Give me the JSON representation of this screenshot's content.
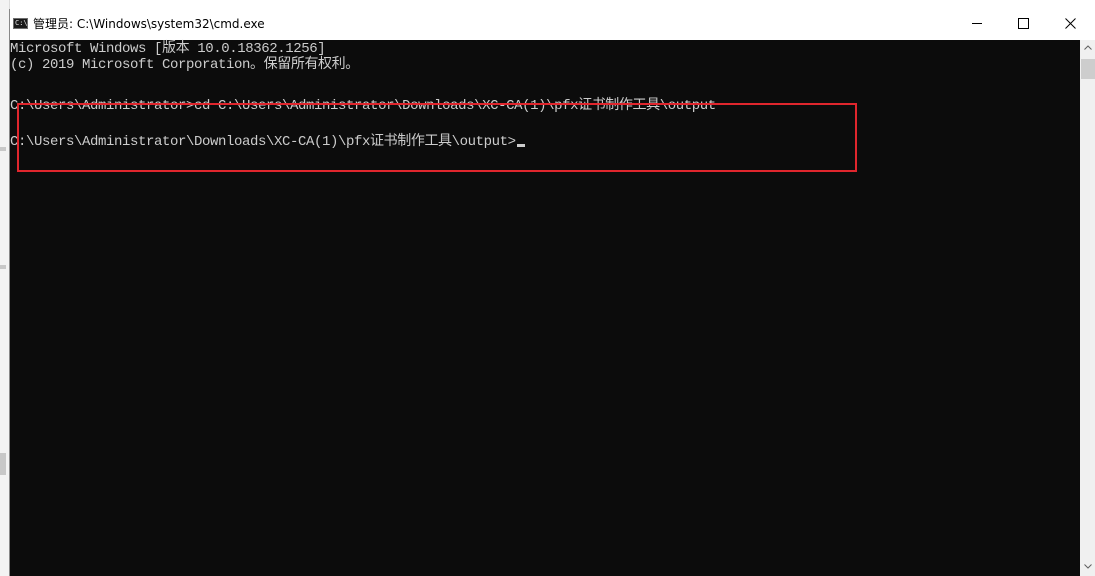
{
  "window": {
    "title": "管理员: C:\\Windows\\system32\\cmd.exe",
    "app_icon": "cmd-icon",
    "app_icon_glyph": "C:\\",
    "controls": {
      "minimize": "minimize-icon",
      "maximize": "maximize-icon",
      "close": "close-icon"
    }
  },
  "console": {
    "lines": [
      "Microsoft Windows [版本 10.0.18362.1256]",
      "(c) 2019 Microsoft Corporation。保留所有权利。",
      "C:\\Users\\Administrator>cd C:\\Users\\Administrator\\Downloads\\XC-CA(1)\\pfx证书制作工具\\output",
      "C:\\Users\\Administrator\\Downloads\\XC-CA(1)\\pfx证书制作工具\\output>"
    ],
    "background_color": "#0c0c0c",
    "text_color": "#cccccc"
  },
  "highlight": {
    "color": "#e0262d"
  },
  "scrollbar": {
    "up_icon": "chevron-up-icon",
    "down_icon": "chevron-down-icon"
  }
}
